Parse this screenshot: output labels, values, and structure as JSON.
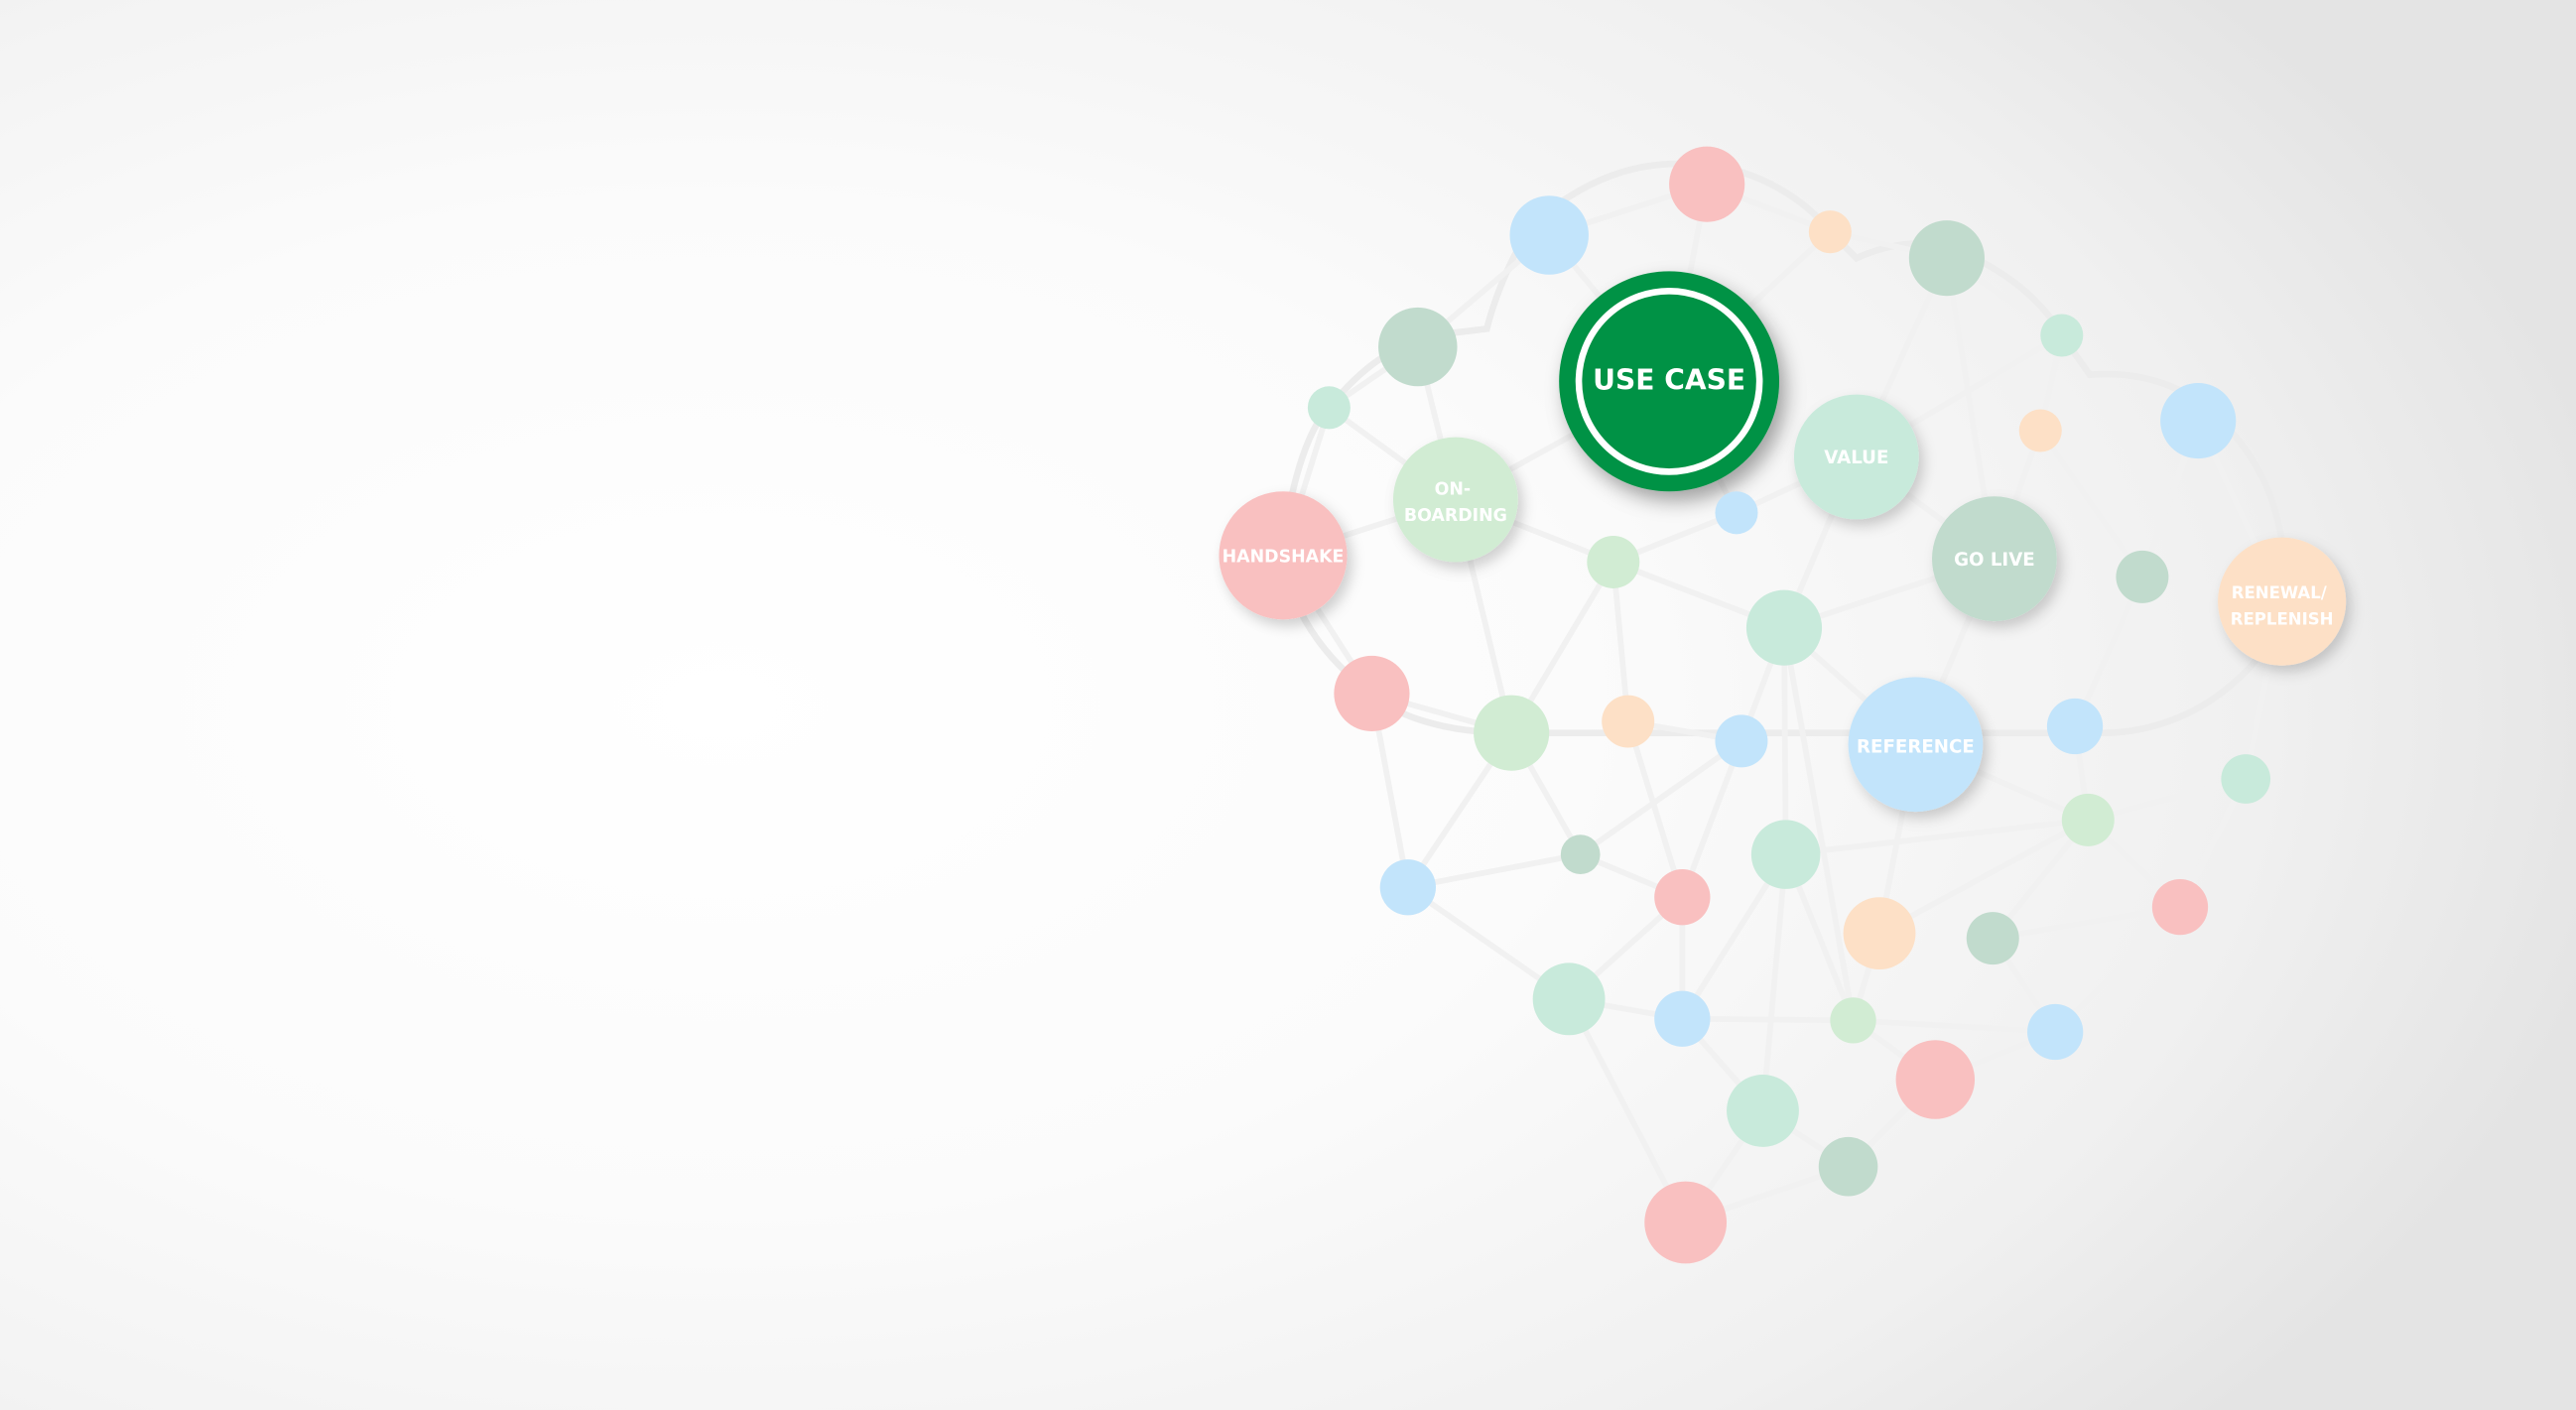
{
  "colors": {
    "pink": "#f9c0c0",
    "blue": "#c2e4fb",
    "peach": "#fde0c6",
    "mint": "#c8eadb",
    "lightgreen": "#d1ecd3",
    "graygreen": "#c1dbcd",
    "accent": "#009245",
    "edge": "#eeeeee"
  },
  "stages": {
    "use_case": "USE CASE",
    "value": "VALUE",
    "onboarding": [
      "ON-",
      "BOARDING"
    ],
    "handshake": "HANDSHAKE",
    "go_live": "GO LIVE",
    "renewal": [
      "RENEWAL/",
      "REPLENISH"
    ],
    "reference": "REFERENCE"
  }
}
